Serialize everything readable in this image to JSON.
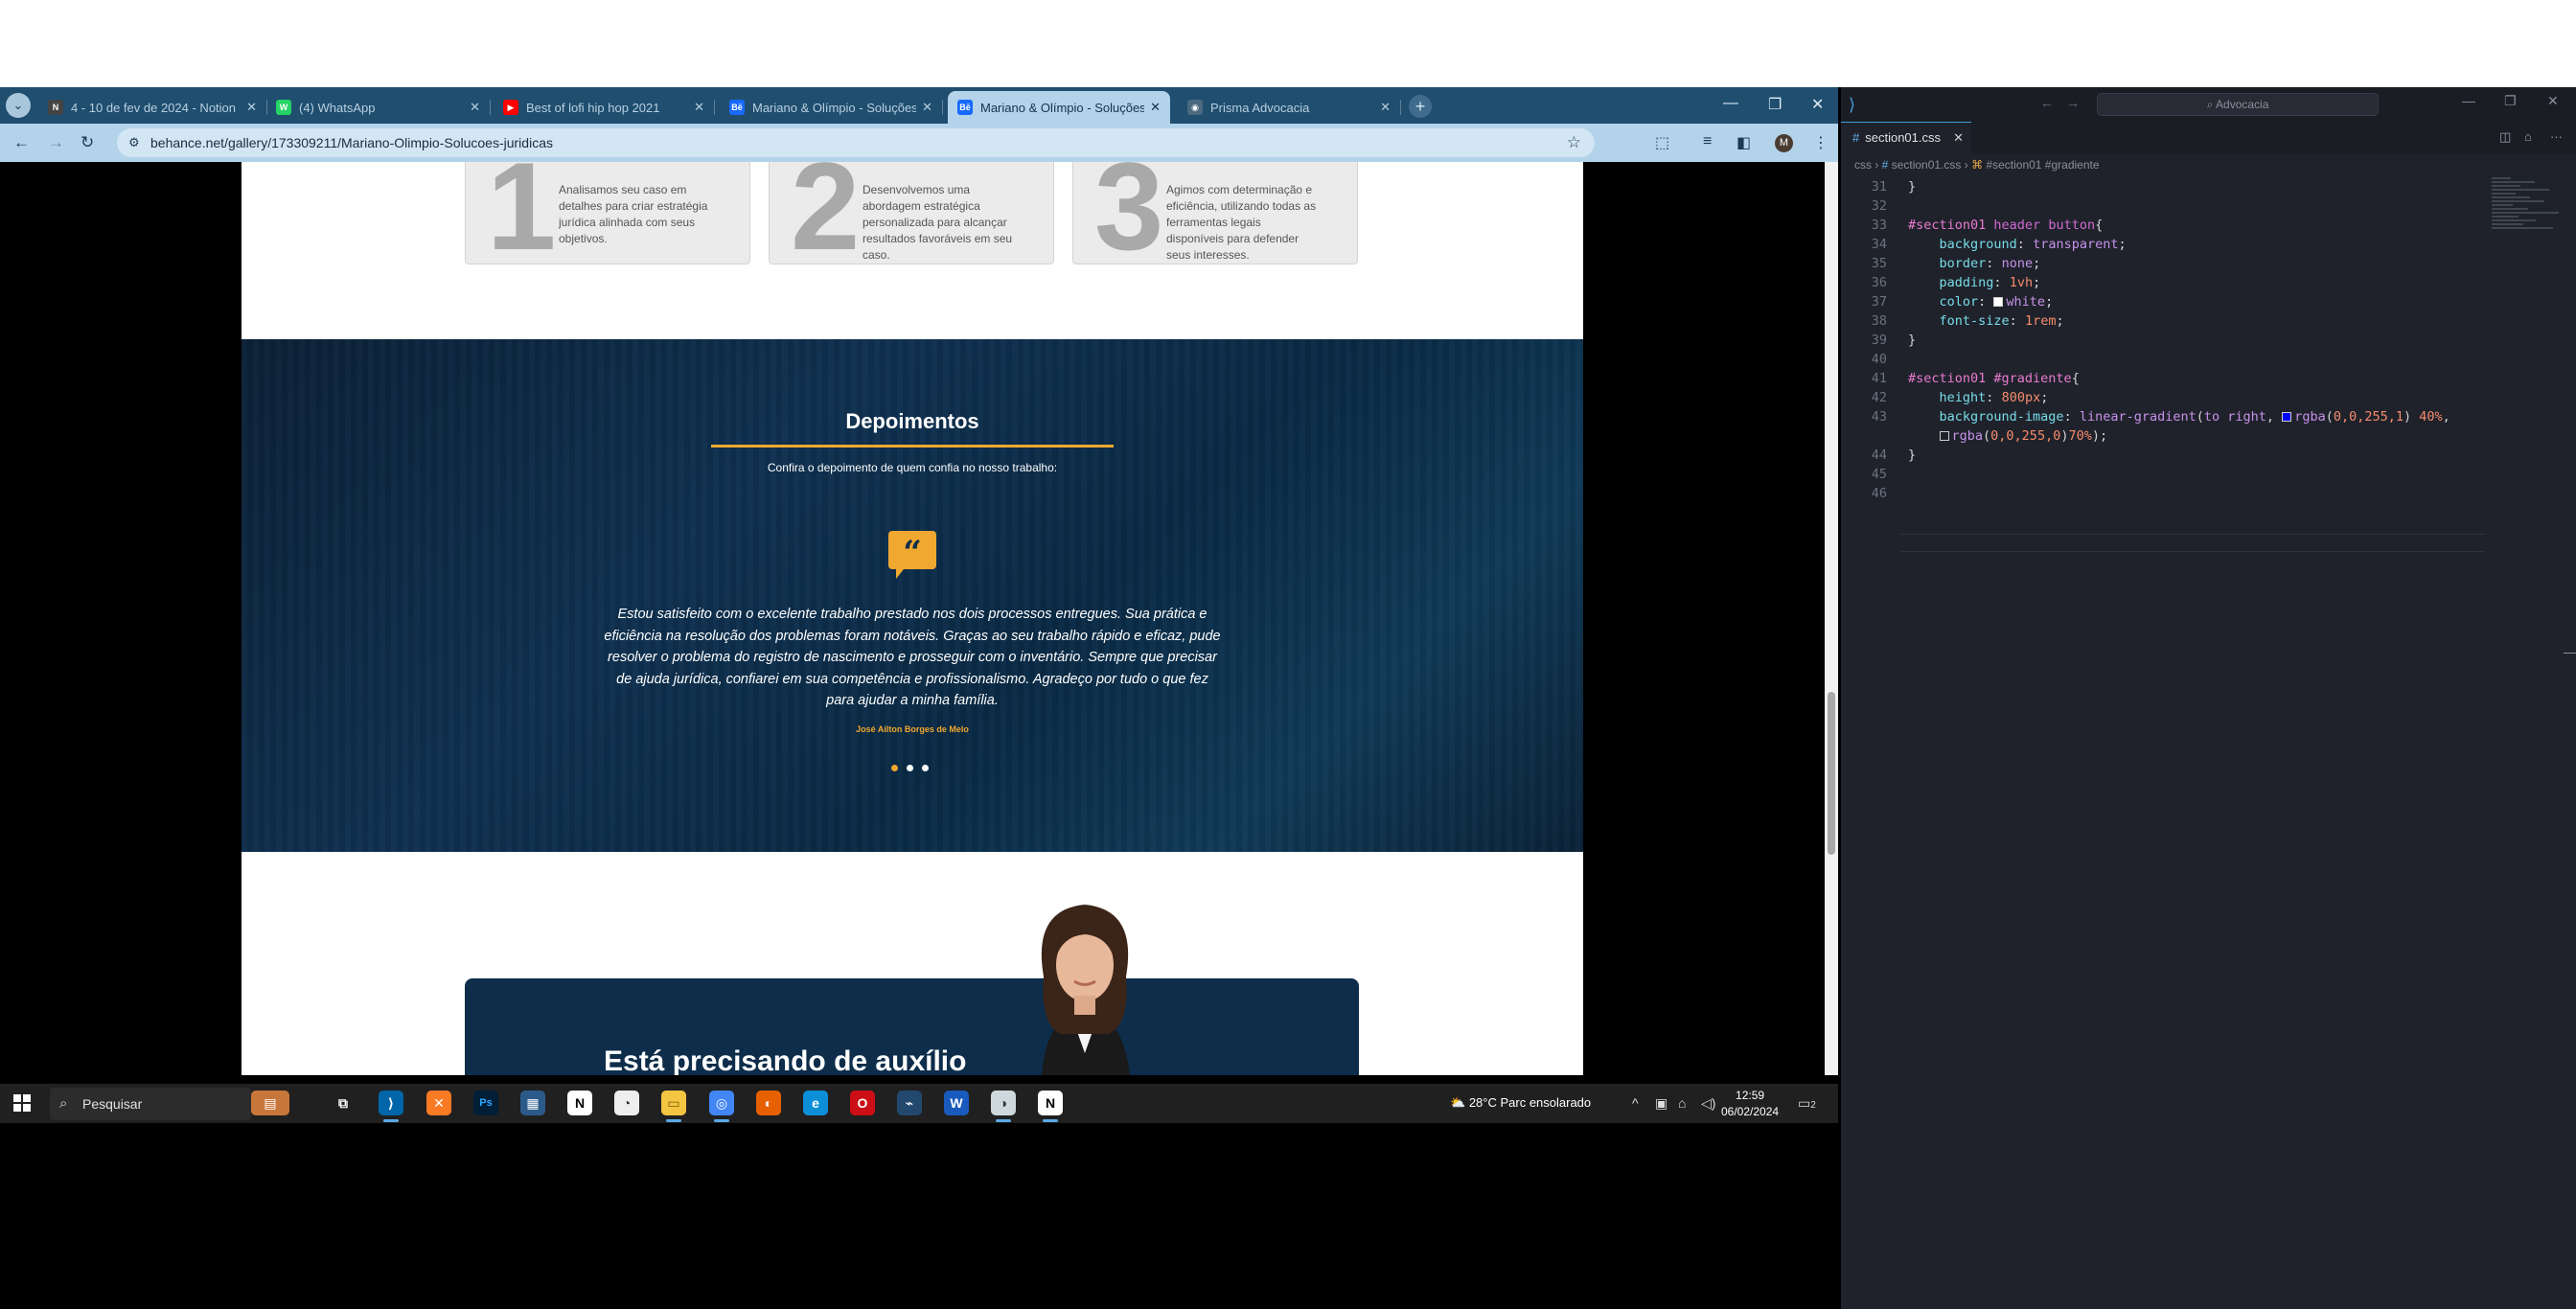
{
  "browser": {
    "tabs": [
      {
        "title": "4 - 10 de fev de 2024 - Notion",
        "favicon": "N",
        "color": "#444444"
      },
      {
        "title": "(4) WhatsApp",
        "favicon": "W",
        "color": "#25d366"
      },
      {
        "title": "Best of lofi hip hop 2021",
        "favicon": "▶",
        "color": "#ff0000"
      },
      {
        "title": "Mariano & Olímpio - Soluções",
        "favicon": "Bē",
        "color": "#1769ff"
      },
      {
        "title": "Mariano & Olímpio - Soluções",
        "favicon": "Bē",
        "color": "#1769ff",
        "active": true
      },
      {
        "title": "Prisma Advocacia",
        "favicon": "◉",
        "color": "#4a6a82"
      }
    ],
    "url": "behance.net/gallery/173309211/Mariano-Olimpio-Solucoes-juridicas"
  },
  "page": {
    "steps": [
      {
        "num": "1",
        "text": "Analisamos seu caso em detalhes para criar estratégia jurídica alinhada com seus objetivos."
      },
      {
        "num": "2",
        "text": "Desenvolvemos uma abordagem estratégica personalizada para alcançar resultados favoráveis em seu caso."
      },
      {
        "num": "3",
        "text": "Agimos com determinação e eficiência, utilizando todas as ferramentas legais disponíveis para defender seus interesses."
      }
    ],
    "testimonials": {
      "heading": "Depoimentos",
      "subheading": "Confira o depoimento de quem confia no nosso trabalho:",
      "quote_mark": "“",
      "quote": "Estou satisfeito com o excelente trabalho prestado nos dois processos entregues. Sua prática e eficiência na resolução dos problemas foram notáveis. Graças ao seu trabalho rápido e eficaz, pude resolver o problema do registro de nascimento e prosseguir com o inventário. Sempre que precisar de ajuda jurídica, confiarei em sua competência e profissionalismo. Agradeço por tudo o que fez para ajudar a minha família.",
      "author": "José Ailton Borges de Melo"
    },
    "cta_title": "Está precisando de auxílio"
  },
  "taskbar": {
    "search_placeholder": "Pesquisar",
    "weather": "28°C  Parc ensolarado",
    "time": "12:59",
    "date": "06/02/2024",
    "notifications": "2"
  },
  "vscode": {
    "search": "Advocacia",
    "tab": "section01.css",
    "breadcrumb": [
      "css",
      "section01.css",
      "#section01 #gradiente"
    ],
    "code": [
      {
        "n": "31",
        "html": "<span class=\"punc\">}</span>"
      },
      {
        "n": "32",
        "html": ""
      },
      {
        "n": "33",
        "html": "<span class=\"sel\">#section01</span> <span class=\"kw\">header button</span><span class=\"punc\">{</span>"
      },
      {
        "n": "34",
        "html": "    <span class=\"prop\">background</span>: <span class=\"val\">transparent</span>;"
      },
      {
        "n": "35",
        "html": "    <span class=\"prop\">border</span>: <span class=\"val\">none</span>;"
      },
      {
        "n": "36",
        "html": "    <span class=\"prop\">padding</span>: <span class=\"num\">1vh</span>;"
      },
      {
        "n": "37",
        "html": "    <span class=\"prop\">color</span>: <span class=\"sw\" style=\"background:#fff\"></span><span class=\"val\">white</span>;"
      },
      {
        "n": "38",
        "html": "    <span class=\"prop\">font-size</span>: <span class=\"num\">1rem</span>;"
      },
      {
        "n": "39",
        "html": "<span class=\"punc\">}</span>"
      },
      {
        "n": "40",
        "html": ""
      },
      {
        "n": "41",
        "html": "<span class=\"sel\">#section01 #gradiente</span><span class=\"punc\">{</span>"
      },
      {
        "n": "42",
        "html": "    <span class=\"prop\">height</span>: <span class=\"num\">800px</span>;"
      },
      {
        "n": "43",
        "html": "    <span class=\"prop\">background-image</span>: <span class=\"val\">linear-gradient</span>(<span class=\"val\">to right</span>, <span class=\"sw\" style=\"background:#0000ff\"></span><span class=\"val\">rgba</span>(<span class=\"num\">0,0,255,1</span>) <span class=\"num\">40%</span>,"
      },
      {
        "n": "",
        "html": "    <span class=\"sw\" style=\"background:transparent\"></span><span class=\"val\">rgba</span>(<span class=\"num\">0,0,255,0</span>)<span class=\"num\">70%</span>);"
      },
      {
        "n": "44",
        "html": "<span class=\"punc\">}</span>"
      },
      {
        "n": "45",
        "html": ""
      },
      {
        "n": "46",
        "html": ""
      }
    ]
  }
}
